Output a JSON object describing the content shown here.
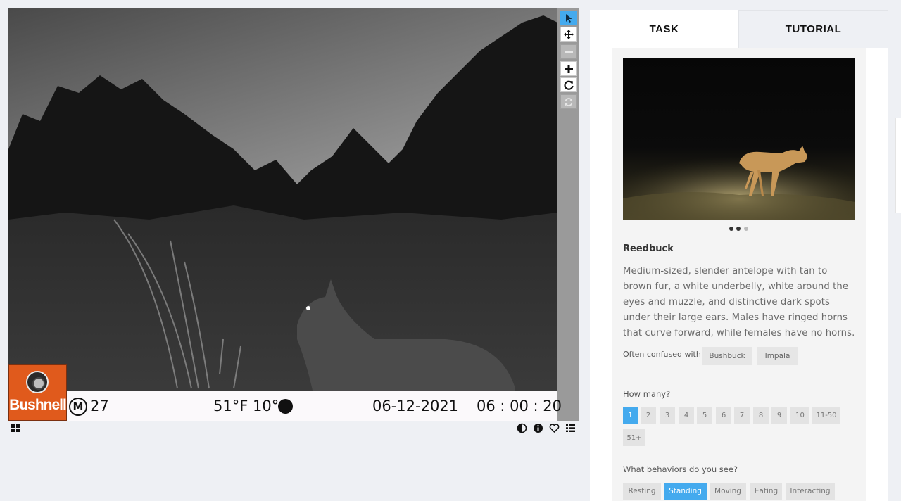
{
  "viewer": {
    "camera_stamp": {
      "brand": "Bushnell",
      "moon_label": "M",
      "frame_number": "27",
      "temperature": "51°F 10°C",
      "date": "06-12-2021",
      "time": "06 : 00 : 20"
    },
    "toolbar": [
      {
        "name": "pointer-tool",
        "icon": "arrow-cursor-icon",
        "state": "active"
      },
      {
        "name": "pan-tool",
        "icon": "move-arrows-icon",
        "state": "normal"
      },
      {
        "name": "zoom-out-tool",
        "icon": "minus-icon",
        "state": "disabled"
      },
      {
        "name": "zoom-in-tool",
        "icon": "plus-icon",
        "state": "normal"
      },
      {
        "name": "rotate-tool",
        "icon": "rotate-icon",
        "state": "normal"
      },
      {
        "name": "reset-tool",
        "icon": "refresh-icon",
        "state": "disabled"
      }
    ],
    "bottom_icons": [
      "grid-icon",
      "contrast-icon",
      "info-icon",
      "heart-icon",
      "list-icon"
    ]
  },
  "tabs": [
    {
      "label": "TASK",
      "active": true
    },
    {
      "label": "TUTORIAL",
      "active": false
    }
  ],
  "species": {
    "name": "Reedbuck",
    "description": "Medium-sized, slender antelope with tan to brown fur, a white underbelly, white around the eyes and muzzle, and distinctive dark spots under their large ears. Males have ringed horns that curve forward, while females have no horns.",
    "confused_label": "Often confused with",
    "confused_with": [
      "Bushbuck",
      "Impala"
    ],
    "carousel": {
      "total": 3,
      "current": 2
    }
  },
  "how_many": {
    "label": "How many?",
    "options": [
      "1",
      "2",
      "3",
      "4",
      "5",
      "6",
      "7",
      "8",
      "9",
      "10",
      "11-50",
      "51+"
    ],
    "selected": "1"
  },
  "behaviors": {
    "label": "What behaviors do you see?",
    "options": [
      "Resting",
      "Standing",
      "Moving",
      "Eating",
      "Interacting"
    ],
    "selected": [
      "Standing"
    ]
  },
  "colors": {
    "accent": "#44aaee",
    "brand_orange": "#e05a1c",
    "panel_bg": "#f4f4f4",
    "page_bg": "#eef0f4"
  }
}
